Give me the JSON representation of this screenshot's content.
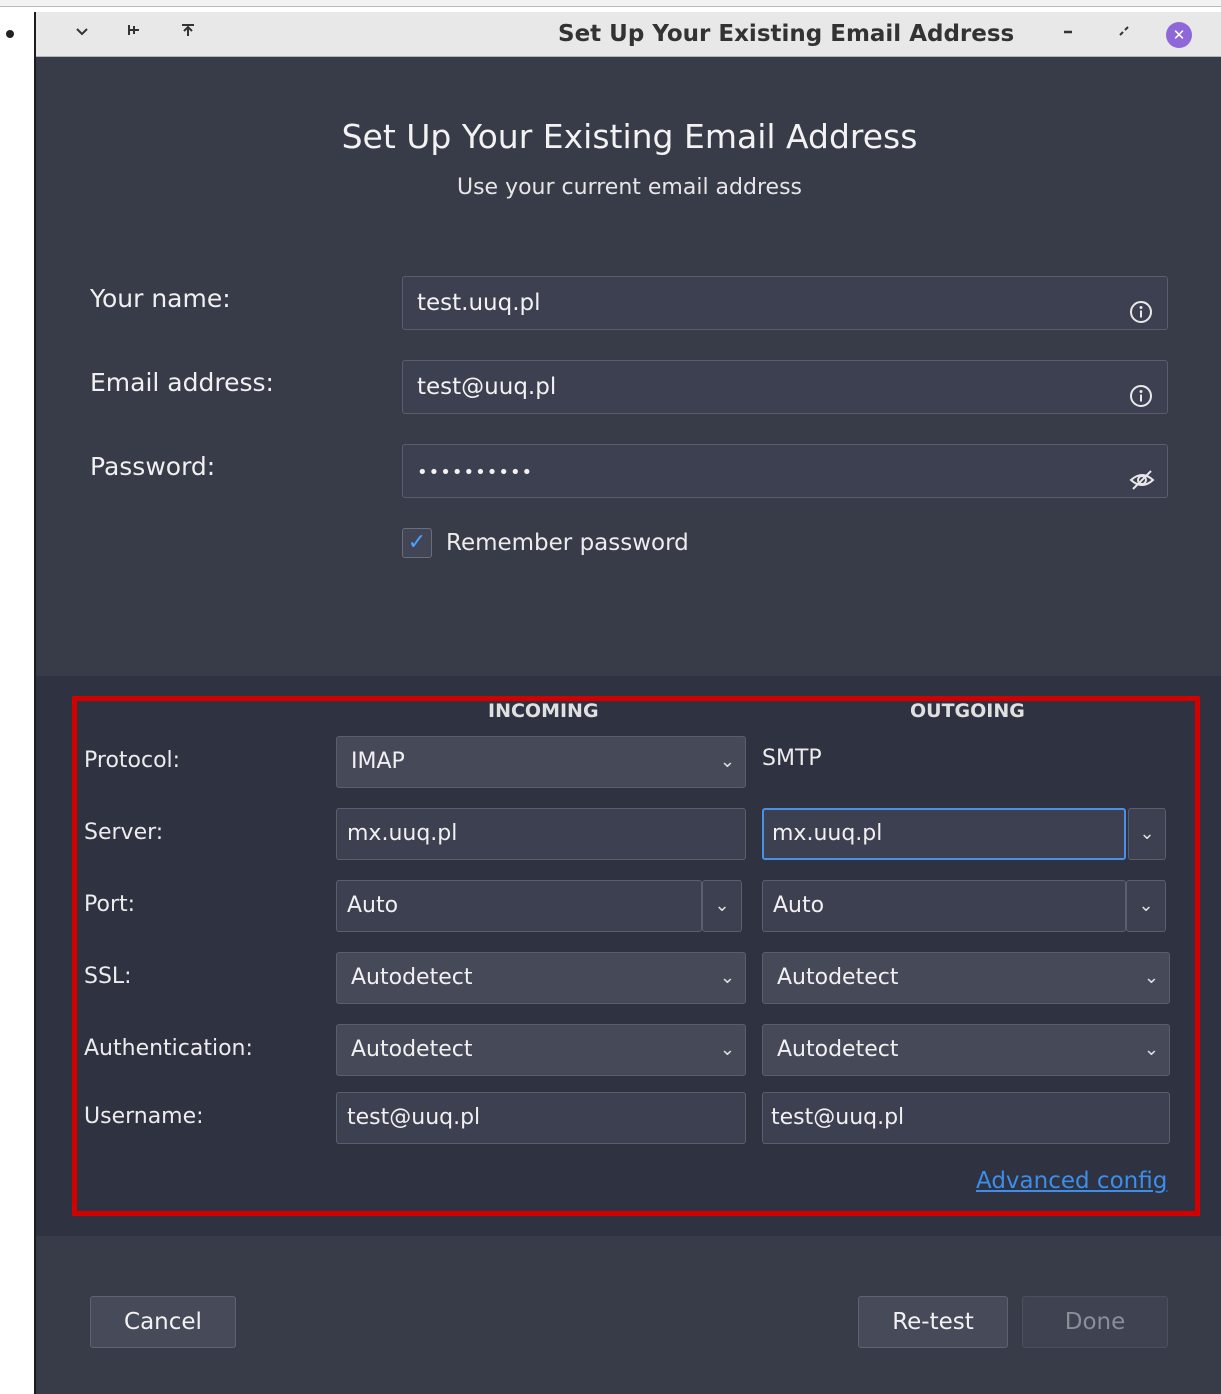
{
  "window": {
    "title": "Set Up Your Existing Email Address",
    "titlebar_icons": [
      "chevron-down-icon",
      "pin-icon",
      "keep-above-icon",
      "minimize-icon",
      "maximize-icon",
      "close-icon"
    ]
  },
  "dialog": {
    "heading": "Set Up Your Existing Email Address",
    "subheading": "Use your current email address"
  },
  "form": {
    "name_label": "Your name:",
    "name_value": "test.uuq.pl",
    "email_label": "Email address:",
    "email_value": "test@uuq.pl",
    "password_label": "Password:",
    "password_value": "••••••••••",
    "remember_label": "Remember password",
    "remember_checked": true
  },
  "config": {
    "incoming_header": "INCOMING",
    "outgoing_header": "OUTGOING",
    "labels": {
      "protocol": "Protocol:",
      "server": "Server:",
      "port": "Port:",
      "ssl": "SSL:",
      "authentication": "Authentication:",
      "username": "Username:"
    },
    "incoming": {
      "protocol": "IMAP",
      "server": "mx.uuq.pl",
      "port": "Auto",
      "ssl": "Autodetect",
      "authentication": "Autodetect",
      "username": "test@uuq.pl"
    },
    "outgoing": {
      "protocol": "SMTP",
      "server": "mx.uuq.pl",
      "port": "Auto",
      "ssl": "Autodetect",
      "authentication": "Autodetect",
      "username": "test@uuq.pl"
    },
    "advanced_link": "Advanced config",
    "highlight_color": "#d40000"
  },
  "buttons": {
    "cancel": "Cancel",
    "retest": "Re-test",
    "done": "Done"
  },
  "colors": {
    "background": "#383b48",
    "field": "#3d4050",
    "link": "#3b8eea",
    "close_button": "#8e67d8"
  }
}
